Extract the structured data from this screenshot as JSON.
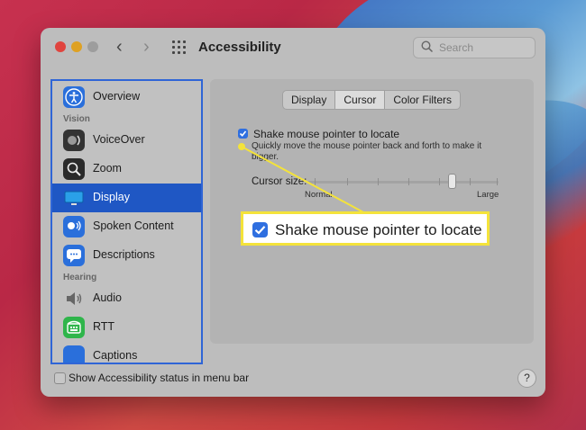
{
  "window": {
    "title": "Accessibility",
    "search_placeholder": "Search"
  },
  "sidebar": {
    "items": [
      {
        "label": "Overview",
        "icon": "accessibility-person-icon",
        "color": "#2a6fdb"
      },
      {
        "label": "VoiceOver",
        "icon": "voiceover-icon",
        "color": "#333333"
      },
      {
        "label": "Zoom",
        "icon": "zoom-icon",
        "color": "#2a2a2a"
      },
      {
        "label": "Display",
        "icon": "display-monitor-icon",
        "color": "#2aa0e8"
      },
      {
        "label": "Spoken Content",
        "icon": "spoken-content-icon",
        "color": "#2a6fdb"
      },
      {
        "label": "Descriptions",
        "icon": "descriptions-speech-icon",
        "color": "#2a6fdb"
      },
      {
        "label": "Audio",
        "icon": "speaker-icon",
        "color": "#8a8a8a"
      },
      {
        "label": "RTT",
        "icon": "rtt-phone-icon",
        "color": "#2fb54b"
      },
      {
        "label": "Captions",
        "icon": "captions-icon",
        "color": "#2a6fdb"
      }
    ],
    "sections": {
      "vision": "Vision",
      "hearing": "Hearing"
    },
    "selected": "Display"
  },
  "tabs": {
    "items": [
      "Display",
      "Cursor",
      "Color Filters"
    ],
    "selected": "Cursor"
  },
  "cursor_pane": {
    "shake_label": "Shake mouse pointer to locate",
    "shake_checked": true,
    "description": "Quickly move the mouse pointer back and forth to make it bigger.",
    "cursor_size_label": "Cursor size:",
    "slider_min": "Normal",
    "slider_max": "Large",
    "slider_value": 0.74
  },
  "bottom": {
    "status_label": "Show Accessibility status in menu bar",
    "status_checked": false,
    "help_label": "?"
  },
  "callout": {
    "text": "Shake mouse pointer to locate",
    "highlight_color": "#f4e33a"
  }
}
